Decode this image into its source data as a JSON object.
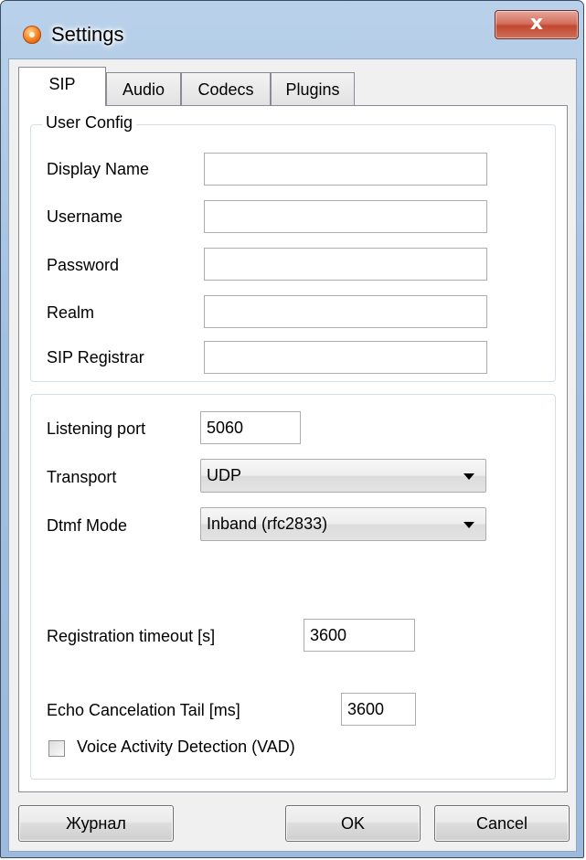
{
  "window": {
    "title": "Settings",
    "close_glyph": "x"
  },
  "tabs": [
    {
      "label": "SIP",
      "active": true
    },
    {
      "label": "Audio",
      "active": false
    },
    {
      "label": "Codecs",
      "active": false
    },
    {
      "label": "Plugins",
      "active": false
    }
  ],
  "user_config": {
    "group_title": "User Config",
    "fields": [
      {
        "label": "Display Name",
        "value": ""
      },
      {
        "label": "Username",
        "value": ""
      },
      {
        "label": "Password",
        "value": ""
      },
      {
        "label": "Realm",
        "value": ""
      },
      {
        "label": "SIP Registrar",
        "value": ""
      }
    ]
  },
  "network": {
    "listening_port": {
      "label": "Listening port",
      "value": "5060"
    },
    "transport": {
      "label": "Transport",
      "value": "UDP"
    },
    "dtmf_mode": {
      "label": "Dtmf Mode",
      "value": "Inband (rfc2833)"
    },
    "registration_timeout": {
      "label": "Registration timeout [s]",
      "value": "3600"
    },
    "echo_cancel_tail": {
      "label": "Echo Cancelation Tail [ms]",
      "value": "3600"
    },
    "vad": {
      "label": "Voice Activity Detection (VAD)",
      "checked": false
    }
  },
  "buttons": {
    "journal": "Журнал",
    "ok": "OK",
    "cancel": "Cancel"
  }
}
